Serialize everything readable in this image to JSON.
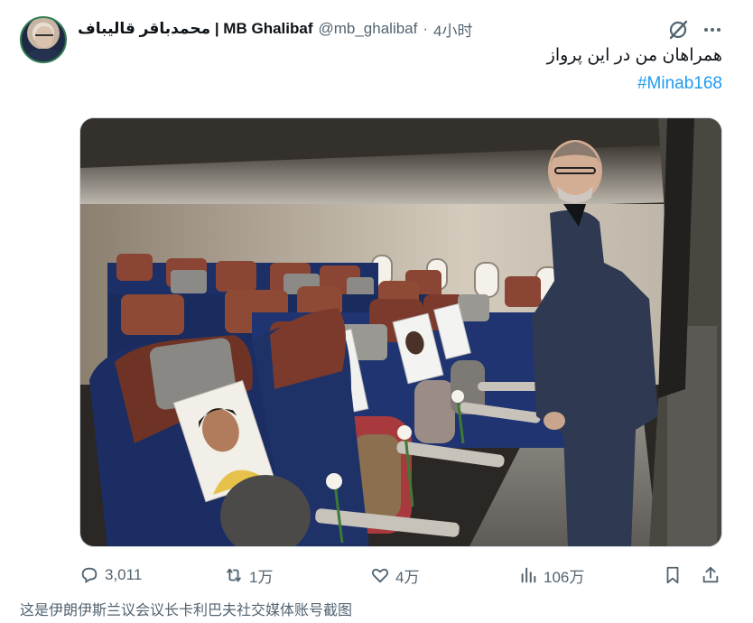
{
  "tweet": {
    "author_name": "محمدباقر قالیباف | MB Ghalibaf",
    "handle": "@mb_ghalibaf",
    "separator": "·",
    "time": "4小时",
    "text": "همراهان من در این پرواز",
    "hashtag": "#Minab168",
    "stats": {
      "replies": "3,011",
      "reposts": "1万",
      "likes": "4万",
      "views": "106万"
    }
  },
  "caption": "这是伊朗伊斯兰议会议长卡利巴夫社交媒体账号截图",
  "colors": {
    "link": "#1d9bf0",
    "muted": "#536471",
    "text": "#0f1419"
  },
  "icons": [
    "grok-icon",
    "more-icon",
    "reply-icon",
    "repost-icon",
    "like-icon",
    "views-icon",
    "bookmark-icon",
    "share-icon"
  ]
}
